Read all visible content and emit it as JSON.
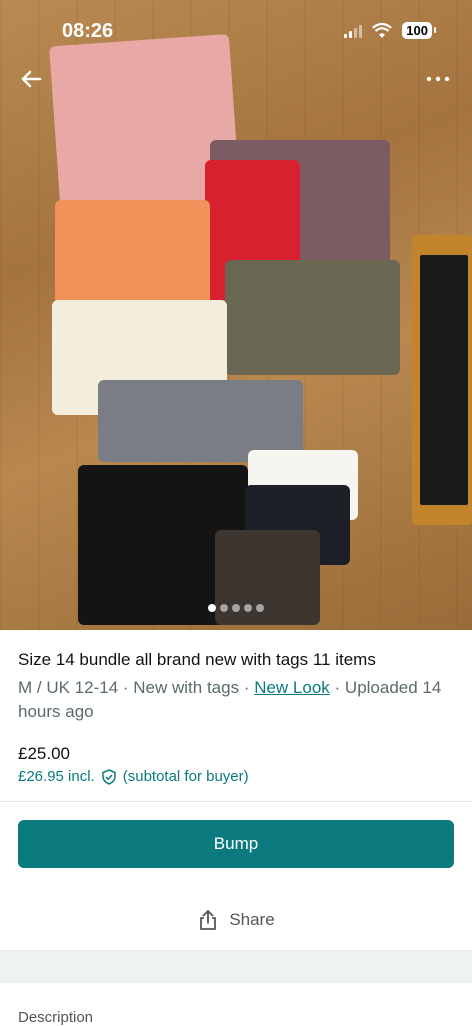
{
  "status_bar": {
    "time": "08:26",
    "battery": "100"
  },
  "top_nav": {
    "back_icon": "back-arrow-icon",
    "more_icon": "more-options-icon"
  },
  "gallery": {
    "image_count": 5,
    "active_index": 0
  },
  "listing": {
    "title": "Size 14 bundle all brand new with tags 11 items",
    "size": "M / UK 12-14",
    "sep1": " · ",
    "condition": "New with tags",
    "sep2": " · ",
    "brand": "New Look",
    "uploaded": " · Uploaded 14 hours ago",
    "price": "£25.00",
    "price_incl": "£26.95 incl.",
    "buyer_note": "(subtotal for buyer)"
  },
  "actions": {
    "bump_label": "Bump",
    "share_label": "Share"
  },
  "section": {
    "description_label": "Description"
  },
  "colors": {
    "accent": "#0a7a7f"
  }
}
